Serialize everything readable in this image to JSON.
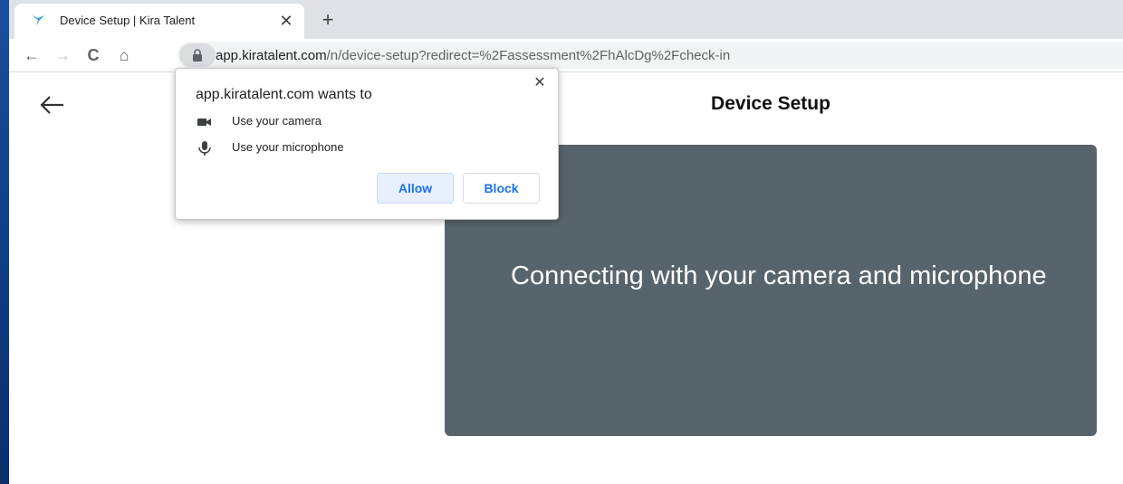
{
  "browser": {
    "tab": {
      "title": "Device Setup | Kira Talent",
      "close_glyph": "✕",
      "favicon": "kira-bird-icon"
    },
    "new_tab_glyph": "+",
    "nav": {
      "back_glyph": "←",
      "forward_glyph": "→",
      "reload_glyph": "C",
      "home_glyph": "⌂"
    },
    "url": {
      "host": "app.kiratalent.com",
      "path": "/n/device-setup?redirect=%2Fassessment%2FhAlcDg%2Fcheck-in"
    }
  },
  "page": {
    "title": "Device Setup",
    "camera_message": "Connecting with your camera and microphone"
  },
  "permission_popup": {
    "title": "app.kiratalent.com wants to",
    "close_glyph": "✕",
    "items": [
      {
        "icon": "video-camera-icon",
        "label": "Use your camera"
      },
      {
        "icon": "microphone-icon",
        "label": "Use your microphone"
      }
    ],
    "allow_label": "Allow",
    "block_label": "Block"
  },
  "colors": {
    "panel": "#57646b",
    "accent": "#1a73e8",
    "desktop": "#123a7a"
  }
}
